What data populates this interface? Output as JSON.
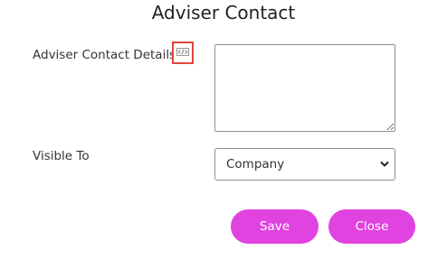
{
  "dialog": {
    "title": "Adviser Contact"
  },
  "form": {
    "details_label": "Adviser Contact Details",
    "details_value": "",
    "visible_to_label": "Visible To",
    "visible_to_value": "Company"
  },
  "icons": {
    "source_code": "code-icon",
    "select_arrow": "chevron-down-icon"
  },
  "actions": {
    "save_label": "Save",
    "close_label": "Close"
  },
  "colors": {
    "button": "#e043e0",
    "highlight": "#e1463f"
  }
}
